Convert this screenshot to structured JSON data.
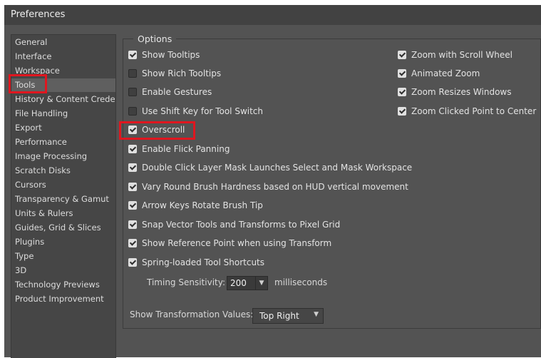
{
  "window": {
    "title": "Preferences"
  },
  "sidebar": {
    "items": [
      {
        "label": "General"
      },
      {
        "label": "Interface"
      },
      {
        "label": "Workspace"
      },
      {
        "label": "Tools",
        "selected": true
      },
      {
        "label": "History & Content Creden..."
      },
      {
        "label": "File Handling"
      },
      {
        "label": "Export"
      },
      {
        "label": "Performance"
      },
      {
        "label": "Image Processing"
      },
      {
        "label": "Scratch Disks"
      },
      {
        "label": "Cursors"
      },
      {
        "label": "Transparency & Gamut"
      },
      {
        "label": "Units & Rulers"
      },
      {
        "label": "Guides, Grid & Slices"
      },
      {
        "label": "Plugins"
      },
      {
        "label": "Type"
      },
      {
        "label": "3D"
      },
      {
        "label": "Technology Previews"
      },
      {
        "label": "Product Improvement"
      }
    ]
  },
  "options": {
    "legend": "Options",
    "left": [
      {
        "label": "Show Tooltips",
        "checked": true
      },
      {
        "label": "Show Rich Tooltips",
        "checked": false
      },
      {
        "label": "Enable Gestures",
        "checked": false
      },
      {
        "label": "Use Shift Key for Tool Switch",
        "checked": false
      },
      {
        "label": "Overscroll",
        "checked": true
      },
      {
        "label": "Enable Flick Panning",
        "checked": true
      },
      {
        "label": "Double Click Layer Mask Launches Select and Mask Workspace",
        "checked": true
      },
      {
        "label": "Vary Round Brush Hardness based on HUD vertical movement",
        "checked": true
      },
      {
        "label": "Arrow Keys Rotate Brush Tip",
        "checked": true
      },
      {
        "label": "Snap Vector Tools and Transforms to Pixel Grid",
        "checked": true
      },
      {
        "label": "Show Reference Point when using Transform",
        "checked": true
      },
      {
        "label": "Spring-loaded Tool Shortcuts",
        "checked": true
      }
    ],
    "right": [
      {
        "label": "Zoom with Scroll Wheel",
        "checked": true
      },
      {
        "label": "Animated Zoom",
        "checked": true
      },
      {
        "label": "Zoom Resizes Windows",
        "checked": true
      },
      {
        "label": "Zoom Clicked Point to Center",
        "checked": true
      }
    ],
    "timing": {
      "label": "Timing Sensitivity:",
      "value": "200",
      "unit": "milliseconds"
    },
    "transform": {
      "label": "Show Transformation Values:",
      "value": "Top Right"
    }
  },
  "highlight_color": "#e0161f"
}
